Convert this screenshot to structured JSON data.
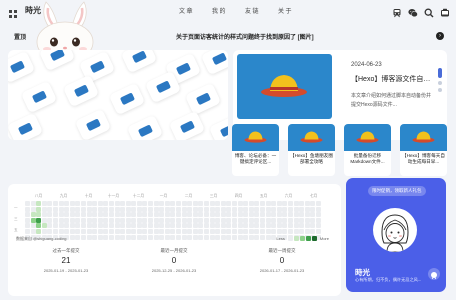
{
  "header": {
    "brand": "時光",
    "nav": [
      {
        "label": "文章"
      },
      {
        "label": "我的"
      },
      {
        "label": "友链"
      },
      {
        "label": "关于"
      }
    ],
    "icons": [
      "train-icon",
      "wechat-icon",
      "search-icon",
      "theme-icon"
    ]
  },
  "notice": {
    "label": "置顶",
    "text": "关于页面访客统计的样式问题终于找到原因了 [图片]"
  },
  "featured": {
    "date": "2024-06-23",
    "title": "【Hexo】博客源文件自动备份",
    "desc": "本文章介绍如何通过脚本自动备份并提交Hexo源码文件..."
  },
  "cards": [
    {
      "title": "博客、论坛必备：一键搞定评论区..."
    },
    {
      "title": "【Hexo】鱼塘朋友圈部署全攻略"
    },
    {
      "title": "批量备份迁移Markdown文件..."
    },
    {
      "title": "【Hexo】博客每天自动生成每日早..."
    }
  ],
  "heatmap": {
    "months": [
      "八月",
      "九月",
      "十月",
      "十一月",
      "十二月",
      "一月",
      "二月",
      "三月",
      "四月",
      "五月",
      "六月",
      "七月"
    ],
    "weekdays": [
      "一",
      "三",
      "五"
    ],
    "source": "数据来自 @shiguang-coding",
    "legend_less": "Less",
    "legend_more": "More",
    "colors": [
      "#ebedf0",
      "#c6e7c0",
      "#8dd18a",
      "#3d9f4a",
      "#1d6a2d"
    ],
    "stats": [
      {
        "label": "过去一年提交",
        "value": "21",
        "range": "2025-01-19 - 2025-01-23"
      },
      {
        "label": "最近一月提交",
        "value": "0",
        "range": "2025-12-25 - 2026-01-23"
      },
      {
        "label": "最近一周提交",
        "value": "0",
        "range": "2026-01-17 - 2026-01-23"
      }
    ]
  },
  "profile": {
    "message": "限时促销，领取新人礼包",
    "name": "時光",
    "bio": "心有所期，归不负，偶许无忌之风..."
  },
  "colors": {
    "accent": "#4b5fe8",
    "card_blue": "#2b87cb",
    "hat": "#f2c11d"
  }
}
